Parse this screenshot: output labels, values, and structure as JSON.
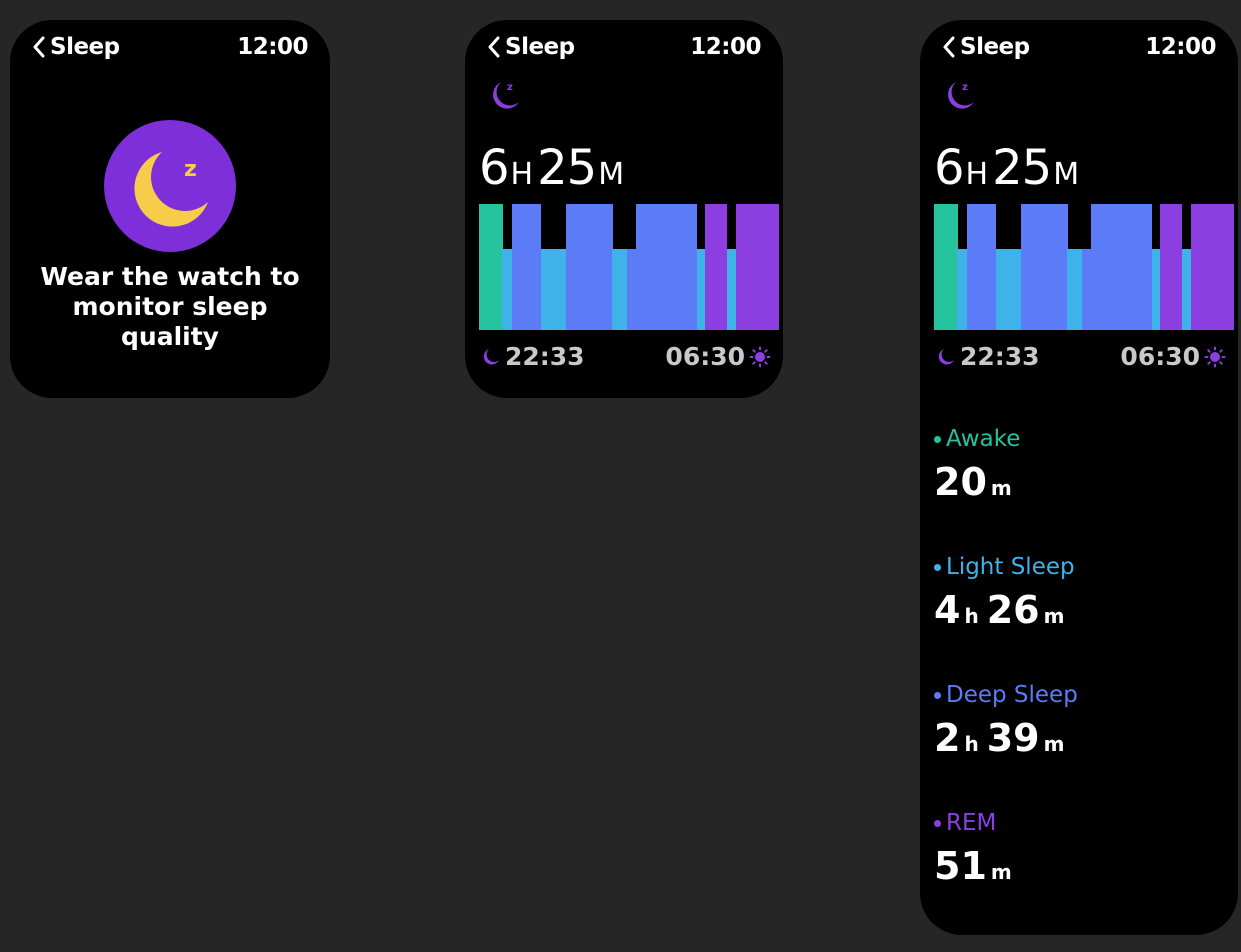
{
  "colors": {
    "awake": "#25c39e",
    "light": "#3fb2ea",
    "deep": "#5b7cf6",
    "rem": "#8b3fe0",
    "moon_badge": "#7f2fd9",
    "moon": "#f6cc4a"
  },
  "screen_empty": {
    "header": {
      "back_label": "Sleep",
      "time": "12:00",
      "back_icon": "chevron-left-icon"
    },
    "icon": "sleep-moon-icon",
    "message": "Wear the watch to monitor sleep quality"
  },
  "screen_summary": {
    "header": {
      "back_label": "Sleep",
      "time": "12:00",
      "back_icon": "chevron-left-icon"
    },
    "icon": "sleep-moon-icon",
    "duration": {
      "hours": "6",
      "hours_unit": "H",
      "minutes": "25",
      "minutes_unit": "M"
    },
    "start_time": "22:33",
    "end_time": "06:30",
    "start_icon": "moon-icon",
    "end_icon": "sun-icon"
  },
  "screen_detail": {
    "header": {
      "back_label": "Sleep",
      "time": "12:00",
      "back_icon": "chevron-left-icon"
    },
    "icon": "sleep-moon-icon",
    "duration": {
      "hours": "6",
      "hours_unit": "H",
      "minutes": "25",
      "minutes_unit": "M"
    },
    "start_time": "22:33",
    "end_time": "06:30",
    "start_icon": "moon-icon",
    "end_icon": "sun-icon",
    "stages": [
      {
        "label": "Awake",
        "color": "#25c39e",
        "parts": [
          {
            "n": "20",
            "u": "m"
          }
        ]
      },
      {
        "label": "Light Sleep",
        "color": "#3fb2ea",
        "parts": [
          {
            "n": "4",
            "u": "h"
          },
          {
            "n": "26",
            "u": "m"
          }
        ]
      },
      {
        "label": "Deep Sleep",
        "color": "#5b7cf6",
        "parts": [
          {
            "n": "2",
            "u": "h"
          },
          {
            "n": "39",
            "u": "m"
          }
        ]
      },
      {
        "label": "REM",
        "color": "#8b3fe0",
        "parts": [
          {
            "n": "51",
            "u": "m"
          }
        ]
      }
    ]
  },
  "chart_data": {
    "type": "bar",
    "description_stage_order": [
      "Awake",
      "Light Sleep",
      "Deep Sleep",
      "REM"
    ],
    "segments": [
      {
        "stage": "Awake",
        "share": 0.08
      },
      {
        "stage": "Light Sleep",
        "share": 0.035
      },
      {
        "stage": "Deep Sleep",
        "share": 0.1
      },
      {
        "stage": "Light Sleep",
        "share": 0.085
      },
      {
        "stage": "Deep Sleep",
        "share": 0.16
      },
      {
        "stage": "Light Sleep",
        "share": 0.05
      },
      {
        "stage": "Deep Sleep",
        "share": 0.24
      },
      {
        "stage": "Light Sleep",
        "share": 0.03
      },
      {
        "stage": "REM",
        "share": 0.075
      },
      {
        "stage": "Light Sleep",
        "share": 0.03
      },
      {
        "stage": "REM",
        "share": 0.145
      }
    ]
  }
}
